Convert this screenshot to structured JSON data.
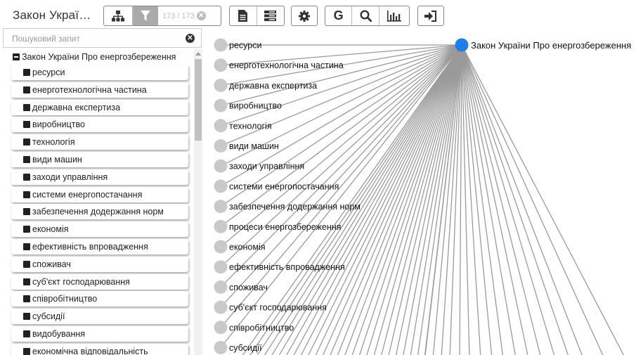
{
  "toolbar": {
    "title": "Закон Украї…",
    "counter": "173 / 173",
    "icons": [
      "sitemap-icon",
      "filter-icon",
      "clear-filter-icon",
      "document-icon",
      "list-icon",
      "gear-icon",
      "google-icon",
      "search-icon",
      "bar-chart-icon",
      "sign-in-icon"
    ]
  },
  "search": {
    "placeholder": "Пошуковий запит",
    "value": ""
  },
  "tree": {
    "root": "Закон України Про енергозбереження",
    "items": [
      "ресурси",
      "енерготехнологічна частина",
      "державна експертиза",
      "виробництво",
      "технологія",
      "види машин",
      "заходи управління",
      "системи енергопостачання",
      "забезпечення додержання норм",
      "економія",
      "ефективність впровадження",
      "споживач",
      "суб'єкт господарювання",
      "співробітництво",
      "субсидії",
      "видобування",
      "економічна відповідальність"
    ]
  },
  "graph": {
    "root_label": "Закон України Про енергозбереження",
    "root_color": "#1e7fe8",
    "node_color": "#c9c9c9",
    "edge_color": "#9a9a9a",
    "nodes": [
      "ресурси",
      "енерготехнологічна частина",
      "державна експертиза",
      "виробництво",
      "технологія",
      "види машин",
      "заходи управління",
      "системи енергопостачання",
      "забезпечення додержання норм",
      "процеси енергозбереження",
      "економія",
      "ефективність впровадження",
      "споживач",
      "суб'єкт господарювання",
      "співробітництво",
      "субсидії"
    ]
  }
}
